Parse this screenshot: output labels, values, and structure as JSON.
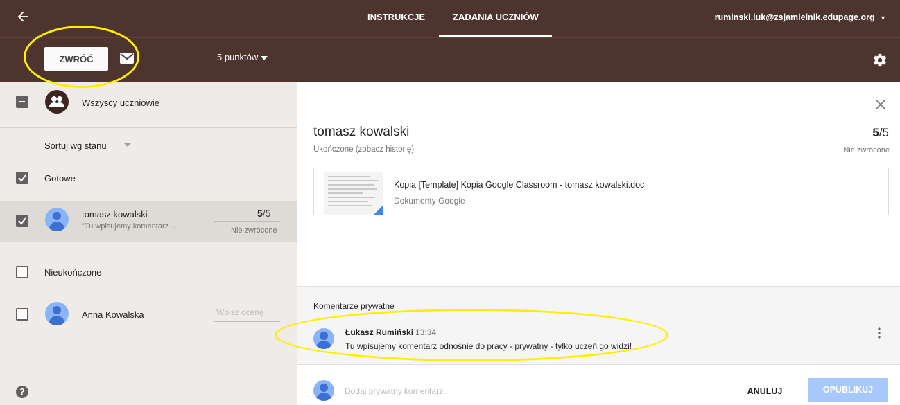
{
  "header": {
    "tabs": [
      {
        "label": "INSTRUKCJE",
        "active": false
      },
      {
        "label": "ZADANIA UCZNIÓW",
        "active": true
      }
    ],
    "account": "ruminski.luk@zsjamielnik.edupage.org"
  },
  "toolbar": {
    "return_label": "ZWRÓĆ",
    "points_label": "5 punktów"
  },
  "sidebar": {
    "all_students": "Wszyscy uczniowie",
    "sort_label": "Sortuj wg stanu",
    "groups": [
      {
        "label": "Gotowe",
        "students": [
          {
            "name": "tomasz kowalski",
            "preview": "\"Tu wpisujemy komentarz ...",
            "grade": "5",
            "grade_max": "/5",
            "status": "Nie zwrócone"
          }
        ]
      },
      {
        "label": "Nieukończone",
        "students": [
          {
            "name": "Anna Kowalska",
            "grade_placeholder": "Wpisz ocenę"
          }
        ]
      }
    ]
  },
  "detail": {
    "student_name": "tomasz kowalski",
    "status": "Ukończone (zobacz historię)",
    "grade": "5",
    "grade_max": "/5",
    "return_status": "Nie zwrócone",
    "attachment": {
      "title": "Kopia [Template] Kopia Google Classroom - tomasz kowalski.doc",
      "type": "Dokumenty Google"
    }
  },
  "comments": {
    "title": "Komentarze prywatne",
    "items": [
      {
        "author": "Łukasz Rumiński",
        "time": "13:34",
        "text": "Tu wpisujemy komentarz odnośnie do pracy - prywatny - tylko uczeń go widzi!"
      }
    ],
    "input_placeholder": "Dodaj prywatny komentarz...",
    "cancel_label": "ANULUJ",
    "publish_label": "OPUBLIKUJ"
  },
  "colors": {
    "header_bg": "#4e342e",
    "sidebar_bg": "#eeebe8",
    "highlight": "#ffee00",
    "publish_disabled": "#a8c7fa"
  }
}
